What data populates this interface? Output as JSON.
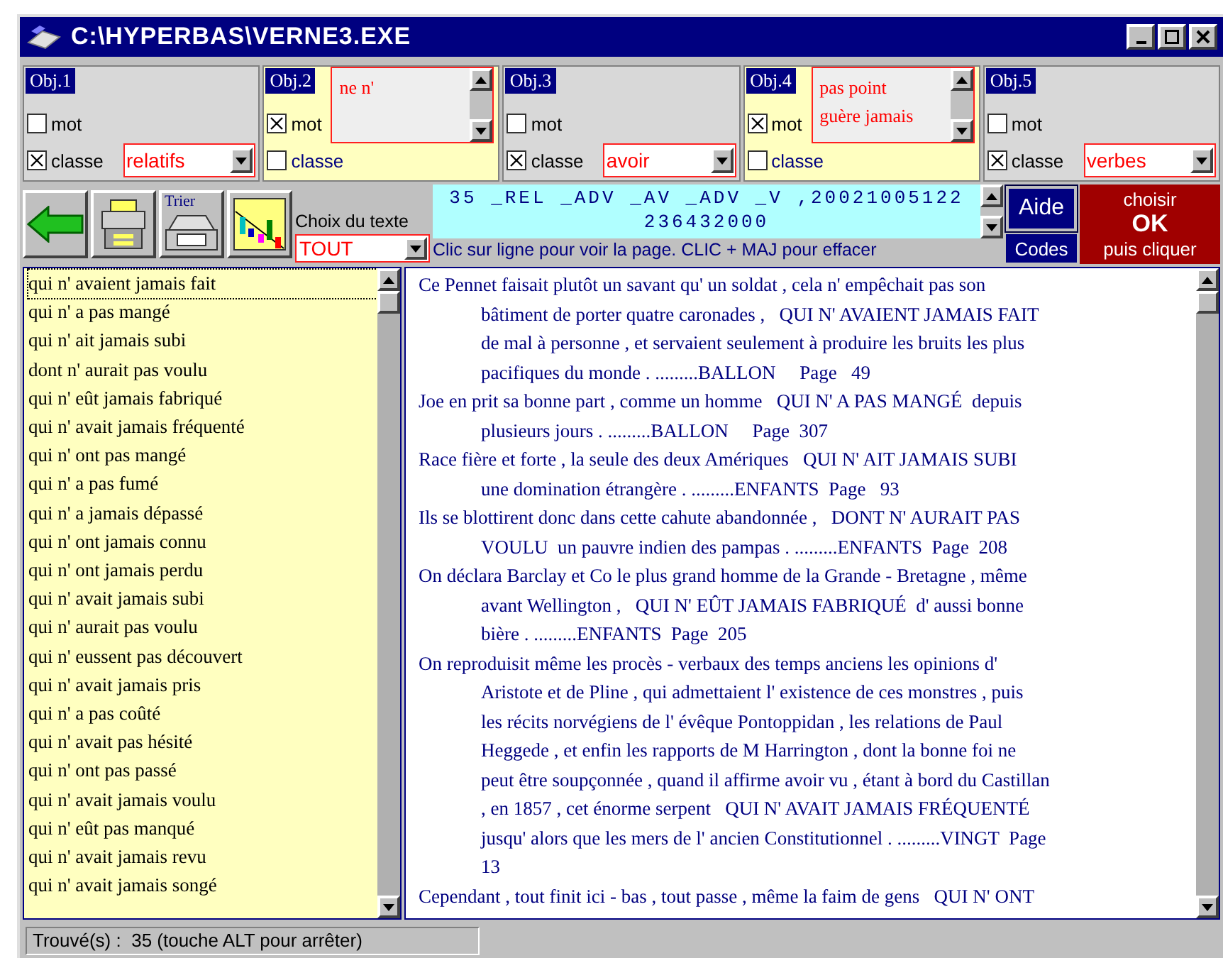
{
  "window": {
    "title": "C:\\HYPERBAS\\VERNE3.EXE"
  },
  "objects": [
    {
      "label": "Obj.1",
      "kind": "classe",
      "mot_label": "mot",
      "classe_label": "classe",
      "mot_checked": false,
      "classe_checked": true,
      "value": "relatifs"
    },
    {
      "label": "Obj.2",
      "kind": "mot",
      "mot_label": "mot",
      "classe_label": "classe",
      "mot_checked": true,
      "classe_checked": false,
      "words": [
        "ne n'"
      ]
    },
    {
      "label": "Obj.3",
      "kind": "classe",
      "mot_label": "mot",
      "classe_label": "classe",
      "mot_checked": false,
      "classe_checked": true,
      "value": "avoir"
    },
    {
      "label": "Obj.4",
      "kind": "mot",
      "mot_label": "mot",
      "classe_label": "classe",
      "mot_checked": true,
      "classe_checked": false,
      "words": [
        "pas point",
        "guère jamais"
      ]
    },
    {
      "label": "Obj.5",
      "kind": "classe",
      "mot_label": "mot",
      "classe_label": "classe",
      "mot_checked": false,
      "classe_checked": true,
      "value": "verbes"
    }
  ],
  "toolbar": {
    "sort_label": "Trier",
    "text_choice_label": "Choix du texte",
    "text_choice_value": "TOUT",
    "code_lines": [
      "35 _REL _ADV _AV _ADV _V ,20021005122",
      "236432000"
    ],
    "hint": "Clic sur ligne pour voir la page. CLIC + MAJ pour effacer",
    "help_button": "Aide",
    "codes_button": "Codes",
    "ok_lines": [
      "choisir",
      "OK",
      "puis cliquer"
    ]
  },
  "results": [
    {
      "text": "qui n' avaient jamais fait",
      "selected": true
    },
    {
      "text": "qui n' a pas mangé",
      "selected": false
    },
    {
      "text": "qui n' ait jamais subi",
      "selected": false
    },
    {
      "text": "dont n' aurait pas voulu",
      "selected": false
    },
    {
      "text": "qui n' eût jamais fabriqué",
      "selected": false
    },
    {
      "text": "qui n' avait jamais fréquenté",
      "selected": false
    },
    {
      "text": "qui n' ont pas mangé",
      "selected": false
    },
    {
      "text": "qui n' a pas fumé",
      "selected": false
    },
    {
      "text": "qui n' a jamais dépassé",
      "selected": false
    },
    {
      "text": "qui n' ont jamais connu",
      "selected": false
    },
    {
      "text": "qui n' ont jamais perdu",
      "selected": false
    },
    {
      "text": "qui n' avait jamais subi",
      "selected": false
    },
    {
      "text": "qui n' aurait pas voulu",
      "selected": false
    },
    {
      "text": "qui n' eussent pas découvert",
      "selected": false
    },
    {
      "text": "qui n' avait jamais pris",
      "selected": false
    },
    {
      "text": "qui n' a pas coûté",
      "selected": false
    },
    {
      "text": "qui n' avait pas hésité",
      "selected": false
    },
    {
      "text": "qui n' ont pas passé",
      "selected": false
    },
    {
      "text": "qui n' avait jamais voulu",
      "selected": false
    },
    {
      "text": "qui n' eût pas manqué",
      "selected": false
    },
    {
      "text": "qui n' avait jamais revu",
      "selected": false
    },
    {
      "text": "qui n' avait jamais songé",
      "selected": false
    }
  ],
  "contexts": [
    {
      "lines": [
        "Ce Pennet faisait plutôt un savant qu' un soldat , cela n' empêchait pas son",
        "bâtiment de porter quatre caronades ,   QUI N' AVAIENT JAMAIS FAIT",
        "de mal à personne , et servaient seulement à produire les bruits les plus",
        "pacifiques du monde . .........BALLON     Page   49"
      ]
    },
    {
      "lines": [
        "Joe en prit sa bonne part , comme un homme   QUI N' A PAS MANGÉ  depuis",
        "plusieurs jours . .........BALLON     Page  307"
      ]
    },
    {
      "lines": [
        "Race fière et forte , la seule des deux Amériques   QUI N' AIT JAMAIS SUBI",
        "une domination étrangère . .........ENFANTS  Page   93"
      ]
    },
    {
      "lines": [
        "Ils se blottirent donc dans cette cahute abandonnée ,   DONT N' AURAIT PAS",
        "VOULU  un pauvre indien des pampas . .........ENFANTS  Page  208"
      ]
    },
    {
      "lines": [
        "On déclara Barclay et Co le plus grand homme de la Grande - Bretagne , même",
        "avant Wellington ,   QUI N' EÛT JAMAIS FABRIQUÉ  d' aussi bonne",
        "bière . .........ENFANTS  Page  205"
      ]
    },
    {
      "lines": [
        "On reproduisit même les procès - verbaux des temps anciens les opinions d'",
        "Aristote et de Pline , qui admettaient l' existence de ces monstres , puis",
        "les récits norvégiens de l' évêque Pontoppidan , les relations de Paul",
        "Heggede , et enfin les rapports de M Harrington , dont la bonne foi ne",
        "peut être soupçonnée , quand il affirme avoir vu , étant à bord du Castillan",
        ", en 1857 , cet énorme serpent   QUI N' AVAIT JAMAIS FRÉQUENTÉ",
        "jusqu' alors que les mers de l' ancien Constitutionnel . .........VINGT  Page",
        "13"
      ]
    },
    {
      "lines": [
        "Cependant , tout finit ici - bas , tout passe , même la faim de gens   QUI N' ONT"
      ]
    }
  ],
  "status_bar": "Trouvé(s) :  35 (touche ALT pour arrêter)"
}
